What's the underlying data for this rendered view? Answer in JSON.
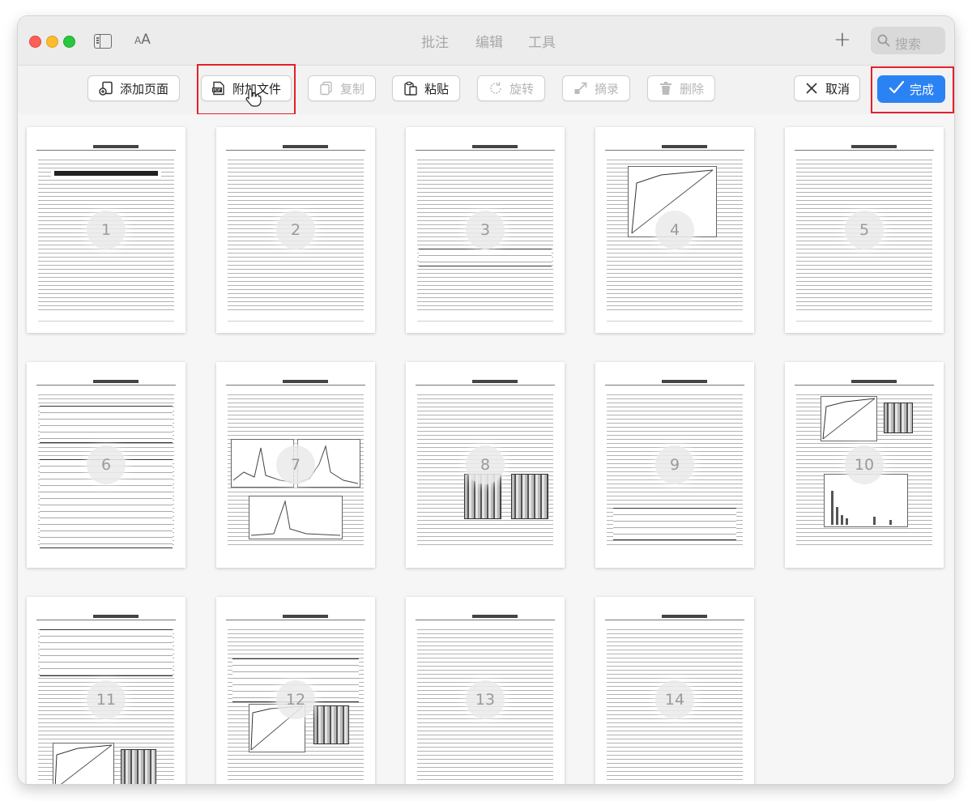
{
  "menu": {
    "annotate": "批注",
    "edit": "编辑",
    "tools": "工具"
  },
  "search": {
    "placeholder": "搜索"
  },
  "toolbar": {
    "add_page": "添加页面",
    "attach_file": "附加文件",
    "copy": "复制",
    "paste": "粘贴",
    "rotate": "旋转",
    "extract": "摘录",
    "delete": "删除",
    "cancel": "取消",
    "done": "完成"
  },
  "icons": {
    "sidebar": "sidebar-icon",
    "font_size": "font-size-icon",
    "add": "plus-icon",
    "search": "search-icon",
    "pdf": "pdf-file-icon",
    "cursor": "pointer-hand-icon"
  },
  "colors": {
    "accent": "#2b82f3",
    "highlight": "#e5202a"
  },
  "pages": [
    "1",
    "2",
    "3",
    "4",
    "5",
    "6",
    "7",
    "8",
    "9",
    "10",
    "11",
    "12",
    "13",
    "14"
  ]
}
